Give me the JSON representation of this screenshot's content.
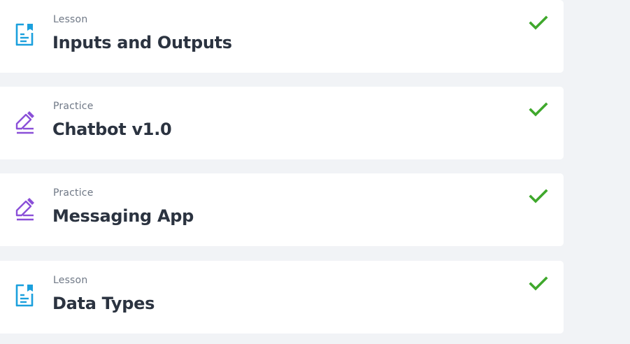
{
  "colors": {
    "page_background": "#f1f3f6",
    "card_background": "#ffffff",
    "lesson_icon": "#1ba0dd",
    "practice_icon": "#8a4fd8",
    "check": "#3fa82c",
    "type_label": "#6f7886",
    "title": "#2b3340"
  },
  "items": [
    {
      "type": "Lesson",
      "title": "Inputs and Outputs",
      "icon": "document-icon",
      "completed": true
    },
    {
      "type": "Practice",
      "title": "Chatbot v1.0",
      "icon": "pencil-icon",
      "completed": true
    },
    {
      "type": "Practice",
      "title": "Messaging App",
      "icon": "pencil-icon",
      "completed": true
    },
    {
      "type": "Lesson",
      "title": "Data Types",
      "icon": "document-icon",
      "completed": true
    }
  ]
}
